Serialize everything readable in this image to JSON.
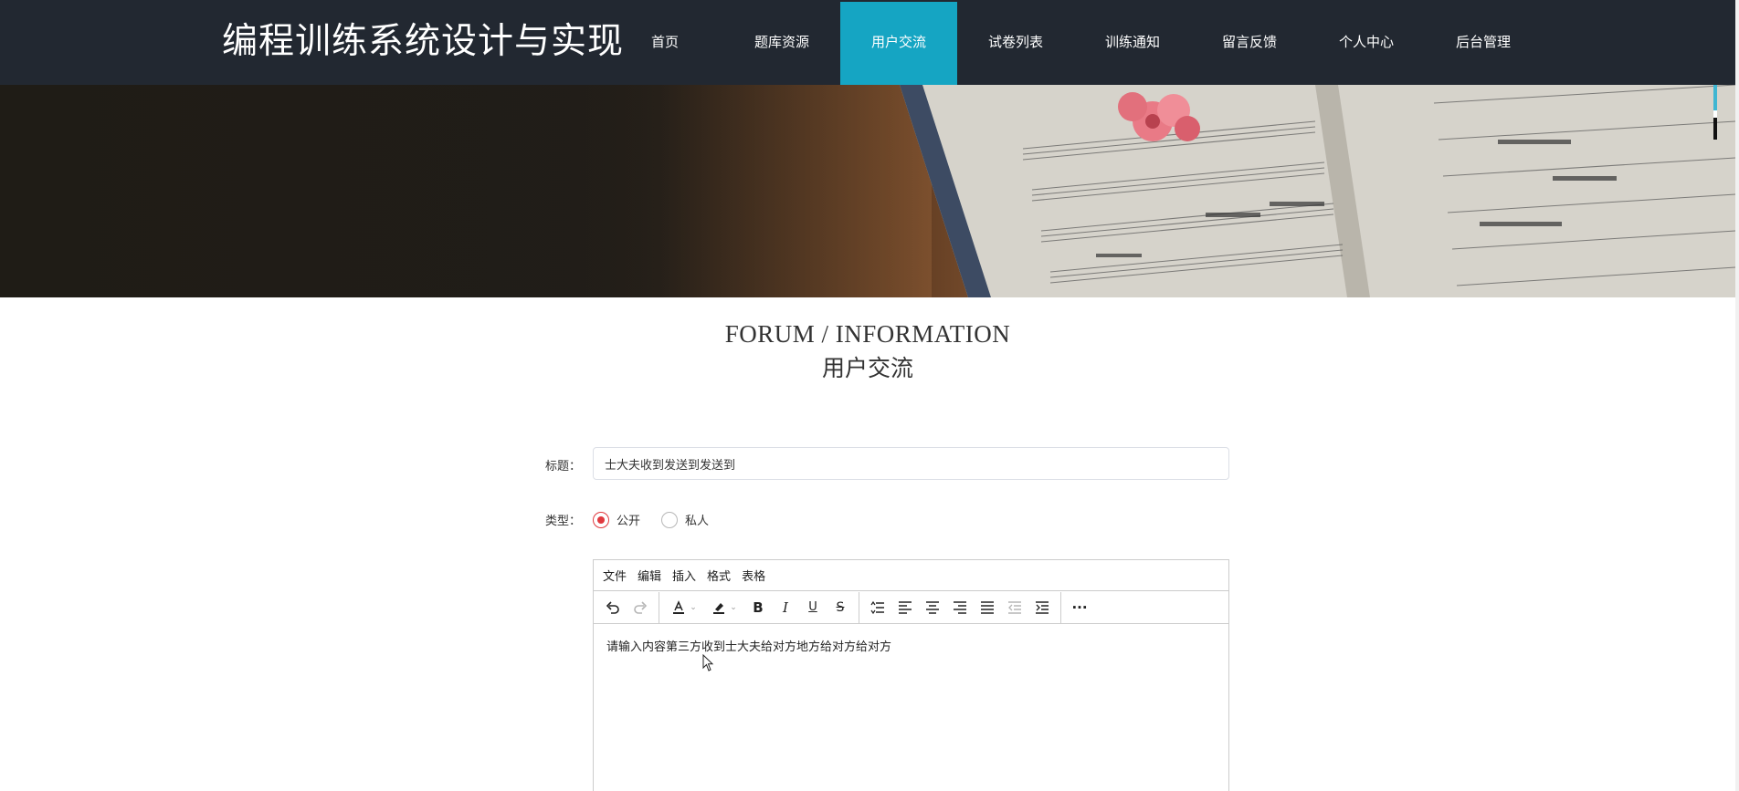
{
  "site": {
    "title": "编程训练系统设计与实现"
  },
  "nav": {
    "items": [
      {
        "label": "首页"
      },
      {
        "label": "题库资源"
      },
      {
        "label": "用户交流"
      },
      {
        "label": "试卷列表"
      },
      {
        "label": "训练通知"
      },
      {
        "label": "留言反馈"
      },
      {
        "label": "个人中心"
      },
      {
        "label": "后台管理"
      }
    ],
    "active_index": 2
  },
  "colors": {
    "header_bg": "#222831",
    "active_nav": "#15a5c3",
    "radio_checked": "#e0393e"
  },
  "heading": {
    "en": "FORUM / INFORMATION",
    "cn": "用户交流"
  },
  "form": {
    "title_label": "标题：",
    "title_value": "士大夫收到发送到发送到",
    "type_label": "类型：",
    "type_options": [
      {
        "label": "公开",
        "checked": true
      },
      {
        "label": "私人",
        "checked": false
      }
    ]
  },
  "editor": {
    "menu": [
      "文件",
      "编辑",
      "插入",
      "格式",
      "表格"
    ],
    "content": "请输入内容第三方收到士大夫给对方地方给对方给对方"
  }
}
